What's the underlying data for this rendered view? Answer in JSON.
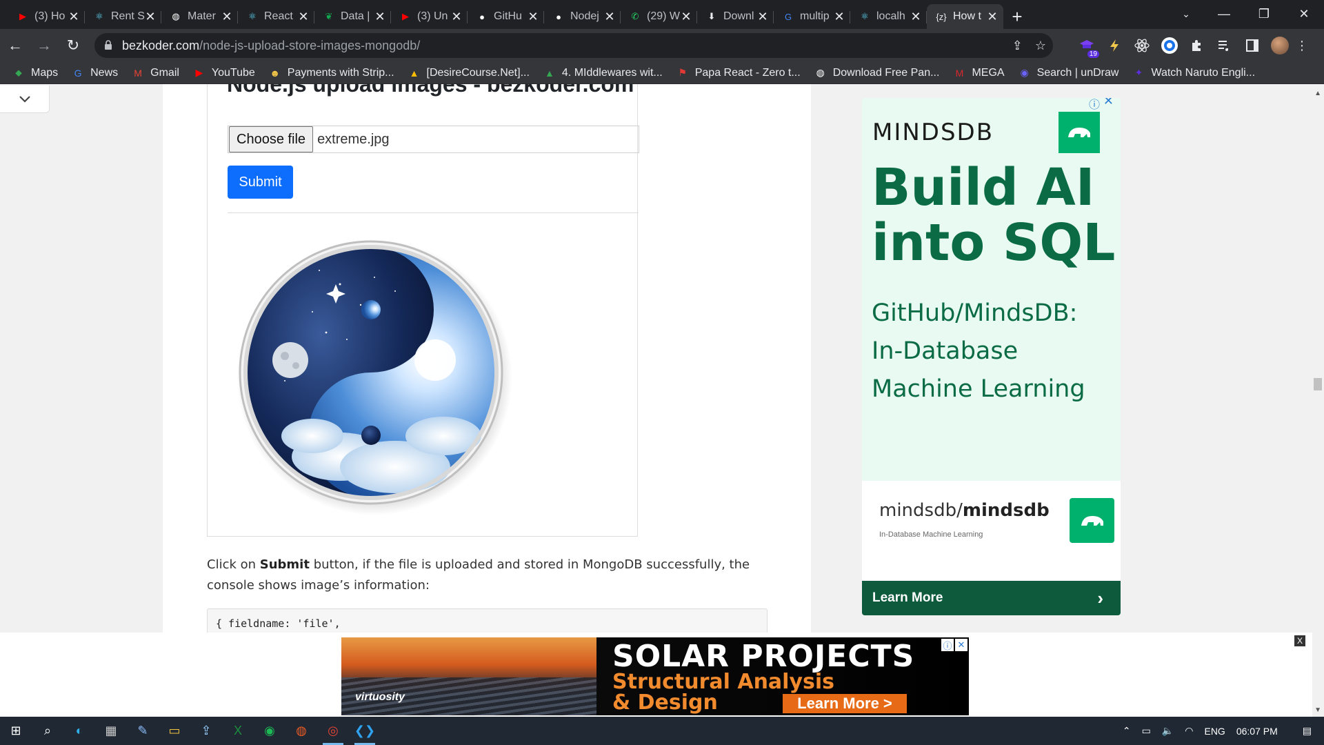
{
  "tabs": [
    {
      "title": "(3) Ho",
      "icon": "youtube-icon",
      "color": "#ff0000"
    },
    {
      "title": "Rent S",
      "icon": "react-icon",
      "color": "#61dafb"
    },
    {
      "title": "Mater",
      "icon": "globe-icon",
      "color": "#ffffff"
    },
    {
      "title": "React",
      "icon": "react-icon",
      "color": "#61dafb"
    },
    {
      "title": "Data |",
      "icon": "mongodb-leaf-icon",
      "color": "#13aa52"
    },
    {
      "title": "(3) Un",
      "icon": "youtube-icon",
      "color": "#ff0000"
    },
    {
      "title": "GitHu",
      "icon": "github-icon",
      "color": "#ffffff"
    },
    {
      "title": "Nodej",
      "icon": "github-icon",
      "color": "#ffffff"
    },
    {
      "title": "(29) W",
      "icon": "whatsapp-icon",
      "color": "#25d366"
    },
    {
      "title": "Downl",
      "icon": "download-icon",
      "color": "#e8eaed"
    },
    {
      "title": "multip",
      "icon": "google-icon",
      "color": "#4285f4"
    },
    {
      "title": "localh",
      "icon": "react-icon",
      "color": "#61dafb"
    },
    {
      "title": "How t",
      "icon": "bezkoder-icon",
      "color": "#e8eaed"
    }
  ],
  "tab_close": "✕",
  "new_tab": "+",
  "window_controls": {
    "minimize": "—",
    "restore": "❐",
    "close": "✕"
  },
  "tab_search": "⌄",
  "toolbar": {
    "back": "←",
    "forward": "→",
    "reload": "↻",
    "url_host": "bezkoder.com",
    "url_path": "/node-js-upload-store-images-mongodb/",
    "lock": "🔒",
    "share": "⇪",
    "star": "☆",
    "extensions": [
      "graduation-cap-icon",
      "bolt-icon",
      "react-devtools-icon",
      "circle-logo-icon",
      "puzzle-icon",
      "media-queue-icon",
      "sidebar-icon"
    ],
    "extension_badge": "19"
  },
  "bookmarks": [
    {
      "label": "Maps",
      "icon": "maps-icon",
      "color": "#34a853"
    },
    {
      "label": "News",
      "icon": "news-icon",
      "color": "#4285f4"
    },
    {
      "label": "Gmail",
      "icon": "gmail-icon",
      "color": "#ea4335"
    },
    {
      "label": "YouTube",
      "icon": "youtube-icon",
      "color": "#ff0000"
    },
    {
      "label": "Payments with Strip...",
      "icon": "emoji-icon",
      "color": "#f7c948"
    },
    {
      "label": "[DesireCourse.Net]...",
      "icon": "drive-icon",
      "color": "#fbbc04"
    },
    {
      "label": "4. MIddlewares wit...",
      "icon": "drive-icon",
      "color": "#34a853"
    },
    {
      "label": "Papa React - Zero t...",
      "icon": "flag-icon",
      "color": "#e53935"
    },
    {
      "label": "Download Free Pan...",
      "icon": "globe-icon",
      "color": "#ffffff"
    },
    {
      "label": "MEGA",
      "icon": "mega-icon",
      "color": "#d9272e"
    },
    {
      "label": "Search | unDraw",
      "icon": "undraw-icon",
      "color": "#6c63ff"
    },
    {
      "label": "Watch Naruto Engli...",
      "icon": "naruto-icon",
      "color": "#5b2ee0"
    }
  ],
  "page": {
    "demo_title": "Node.js upload images - bezkoder.com",
    "choose_file_label": "Choose file",
    "file_name": "extreme.jpg",
    "submit_label": "Submit",
    "para_before": "Click on ",
    "para_bold": "Submit",
    "para_after": " button, if the file is uploaded and stored in MongoDB successfully, the console shows image’s information:",
    "code_line": "{ fieldname: 'file',"
  },
  "side_ad": {
    "brand": "MINDSDB",
    "headline_1": "Build AI",
    "headline_2": "into SQL",
    "sub_1": "GitHub/MindsDB:",
    "sub_2": "In-Database",
    "sub_3": "Machine Learning",
    "repo_owner": "mindsdb/",
    "repo_name": "mindsdb",
    "repo_desc": "In-Database Machine Learning",
    "cta": "Learn More",
    "info": "ⓘ",
    "close": "✕"
  },
  "bottom_ad": {
    "logo_text": "virtuosity",
    "title": "SOLAR PROJECTS",
    "sub_1": "Structural Analysis",
    "sub_2": "& Design",
    "cta": "Learn More >",
    "close": "X"
  },
  "taskbar": {
    "apps": [
      "windows-start-icon",
      "search-icon",
      "edge-icon",
      "calculator-icon",
      "notes-icon",
      "file-explorer-icon",
      "upload-icon",
      "excel-icon",
      "spotify-icon",
      "postman-icon",
      "chrome-icon",
      "vscode-icon"
    ],
    "lang": "ENG",
    "time": "06:07 PM"
  },
  "colors": {
    "submit": "#0d6efd",
    "mindsdb_green": "#00b06d",
    "mindsdb_dark": "#0a6b44"
  }
}
